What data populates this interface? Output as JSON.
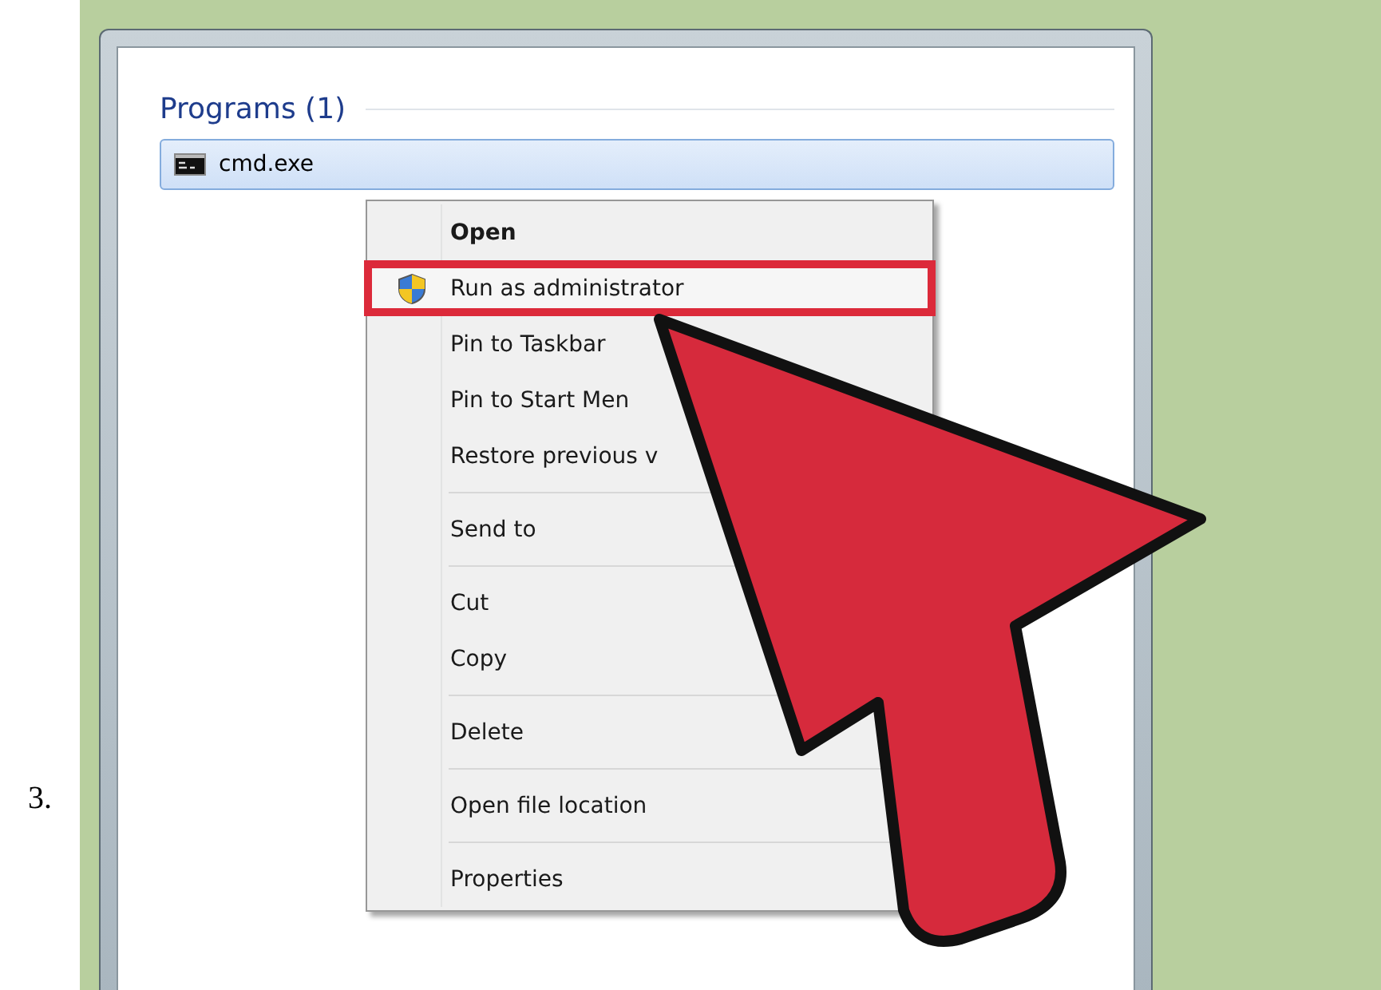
{
  "step_number": "3.",
  "window": {
    "section_title": "Programs (1)",
    "items": [
      {
        "label": "cmd.exe",
        "selected": true
      }
    ]
  },
  "context_menu": {
    "groups": [
      [
        {
          "label": "Open",
          "default": true,
          "highlighted": false,
          "kind": "normal"
        },
        {
          "label": "Run as administrator",
          "default": false,
          "highlighted": true,
          "kind": "elevated"
        },
        {
          "label": "Pin to Taskbar",
          "default": false,
          "highlighted": false,
          "kind": "normal"
        },
        {
          "label": "Pin to Start Men",
          "default": false,
          "highlighted": false,
          "kind": "normal"
        },
        {
          "label": "Restore previous v",
          "default": false,
          "highlighted": false,
          "kind": "normal"
        }
      ],
      [
        {
          "label": "Send to",
          "default": false,
          "highlighted": false,
          "kind": "normal"
        }
      ],
      [
        {
          "label": "Cut",
          "default": false,
          "highlighted": false,
          "kind": "normal"
        },
        {
          "label": "Copy",
          "default": false,
          "highlighted": false,
          "kind": "normal"
        }
      ],
      [
        {
          "label": "Delete",
          "default": false,
          "highlighted": false,
          "kind": "normal"
        }
      ],
      [
        {
          "label": "Open file location",
          "default": false,
          "highlighted": false,
          "kind": "normal"
        }
      ],
      [
        {
          "label": "Properties",
          "default": false,
          "highlighted": false,
          "kind": "normal"
        }
      ]
    ]
  }
}
